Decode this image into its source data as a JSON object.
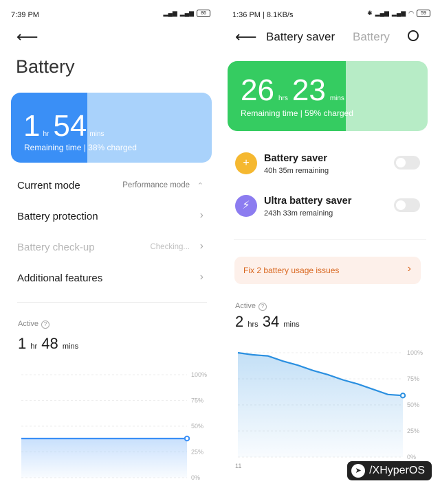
{
  "left": {
    "status": {
      "time": "7:39 PM",
      "battery": "86"
    },
    "title": "Battery",
    "card": {
      "hours": "1",
      "hours_unit": "hr",
      "minutes": "54",
      "minutes_unit": "mins",
      "remaining": "Remaining time | 38% charged",
      "charge_fraction": 0.38,
      "accent": "#3a8ff6",
      "bg": "#a9d2fb"
    },
    "rows": {
      "mode": {
        "label": "Current mode",
        "value": "Performance mode"
      },
      "protection": {
        "label": "Battery protection"
      },
      "checkup": {
        "label": "Battery check-up",
        "value": "Checking..."
      },
      "additional": {
        "label": "Additional features"
      }
    },
    "active": {
      "label": "Active",
      "hours": "1",
      "hours_unit": "hr",
      "minutes": "48",
      "minutes_unit": "mins"
    },
    "chart_data": {
      "type": "line",
      "yticks": [
        "100%",
        "75%",
        "50%",
        "25%",
        "0%"
      ],
      "ylim": [
        0,
        100
      ],
      "series": [
        {
          "values": [
            38,
            38
          ]
        }
      ],
      "color": "#3a8ff6"
    }
  },
  "right": {
    "status": {
      "time": "1:36 PM | 8.1KB/s",
      "battery": "59"
    },
    "header": {
      "title": "Battery saver",
      "tab": "Battery"
    },
    "card": {
      "hours": "26",
      "hours_unit": "hrs",
      "minutes": "23",
      "minutes_unit": "mins",
      "remaining": "Remaining time | 59% charged",
      "charge_fraction": 0.59,
      "accent": "#35cc61",
      "bg": "#b7ecc6"
    },
    "saver": {
      "title": "Battery saver",
      "sub": "40h 35m remaining",
      "color": "#f5b830",
      "icon": "+"
    },
    "ultra": {
      "title": "Ultra battery saver",
      "sub": "243h 33m remaining",
      "color": "#8c7cf0",
      "icon": "⚡"
    },
    "fix": {
      "label": "Fix 2 battery usage issues"
    },
    "active": {
      "label": "Active",
      "hours": "2",
      "hours_unit": "hrs",
      "minutes": "34",
      "minutes_unit": "mins"
    },
    "chart_data": {
      "type": "line",
      "yticks": [
        "100%",
        "75%",
        "50%",
        "25%",
        "0%"
      ],
      "ylim": [
        0,
        100
      ],
      "xlabel_start": "11",
      "series": [
        {
          "values": [
            100,
            98,
            97,
            92,
            88,
            83,
            79,
            74,
            70,
            65,
            60,
            59
          ]
        }
      ],
      "color": "#2a8fe0"
    }
  },
  "watermark": {
    "text": "/XHyperOS"
  }
}
